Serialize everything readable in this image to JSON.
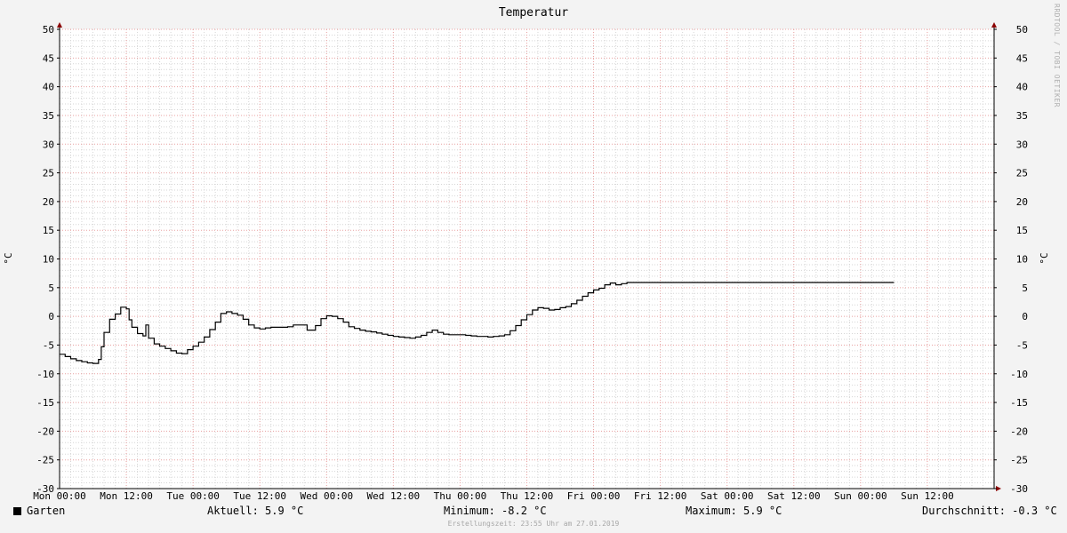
{
  "chart_data": {
    "type": "line",
    "title": "Temperatur",
    "ylabel": "°C",
    "ylabel_right": "°C",
    "ylim": [
      -30,
      50
    ],
    "yticks": [
      50,
      45,
      40,
      35,
      30,
      25,
      20,
      15,
      10,
      5,
      0,
      -5,
      -10,
      -15,
      -20,
      -25,
      -30
    ],
    "xlim_hours": [
      0,
      168
    ],
    "xticks": [
      {
        "label": "Mon 00:00",
        "h": 0
      },
      {
        "label": "Mon 12:00",
        "h": 12
      },
      {
        "label": "Tue 00:00",
        "h": 24
      },
      {
        "label": "Tue 12:00",
        "h": 36
      },
      {
        "label": "Wed 00:00",
        "h": 48
      },
      {
        "label": "Wed 12:00",
        "h": 60
      },
      {
        "label": "Thu 00:00",
        "h": 72
      },
      {
        "label": "Thu 12:00",
        "h": 84
      },
      {
        "label": "Fri 00:00",
        "h": 96
      },
      {
        "label": "Fri 12:00",
        "h": 108
      },
      {
        "label": "Sat 00:00",
        "h": 120
      },
      {
        "label": "Sat 12:00",
        "h": 132
      },
      {
        "label": "Sun 00:00",
        "h": 144
      },
      {
        "label": "Sun 12:00",
        "h": 156
      }
    ],
    "grid": true,
    "series": [
      {
        "name": "Garten",
        "color": "#000000",
        "points": [
          [
            0,
            -6.6
          ],
          [
            1,
            -7.0
          ],
          [
            2,
            -7.4
          ],
          [
            3,
            -7.7
          ],
          [
            4,
            -7.9
          ],
          [
            5,
            -8.1
          ],
          [
            6,
            -8.2
          ],
          [
            7,
            -7.5
          ],
          [
            7.5,
            -5.3
          ],
          [
            8,
            -2.8
          ],
          [
            9,
            -0.5
          ],
          [
            10,
            0.4
          ],
          [
            11,
            1.6
          ],
          [
            12,
            1.3
          ],
          [
            12.5,
            -0.6
          ],
          [
            13,
            -1.9
          ],
          [
            14,
            -3.0
          ],
          [
            15,
            -3.4
          ],
          [
            15.5,
            -1.5
          ],
          [
            16,
            -3.8
          ],
          [
            17,
            -4.8
          ],
          [
            18,
            -5.2
          ],
          [
            19,
            -5.6
          ],
          [
            20,
            -6.0
          ],
          [
            21,
            -6.4
          ],
          [
            22,
            -6.5
          ],
          [
            23,
            -5.8
          ],
          [
            24,
            -5.2
          ],
          [
            25,
            -4.5
          ],
          [
            26,
            -3.6
          ],
          [
            27,
            -2.3
          ],
          [
            28,
            -1.0
          ],
          [
            29,
            0.5
          ],
          [
            30,
            0.8
          ],
          [
            31,
            0.5
          ],
          [
            32,
            0.2
          ],
          [
            33,
            -0.5
          ],
          [
            34,
            -1.5
          ],
          [
            35,
            -2.0
          ],
          [
            36,
            -2.2
          ],
          [
            37,
            -2.0
          ],
          [
            38,
            -1.9
          ],
          [
            39,
            -1.9
          ],
          [
            40,
            -1.9
          ],
          [
            41,
            -1.8
          ],
          [
            42,
            -1.5
          ],
          [
            43,
            -1.5
          ],
          [
            44,
            -1.5
          ],
          [
            44.5,
            -2.4
          ],
          [
            45,
            -2.4
          ],
          [
            46,
            -1.6
          ],
          [
            47,
            -0.4
          ],
          [
            48,
            0.1
          ],
          [
            49,
            0.0
          ],
          [
            50,
            -0.4
          ],
          [
            51,
            -1.0
          ],
          [
            52,
            -1.8
          ],
          [
            53,
            -2.1
          ],
          [
            54,
            -2.4
          ],
          [
            55,
            -2.6
          ],
          [
            56,
            -2.7
          ],
          [
            57,
            -2.9
          ],
          [
            58,
            -3.1
          ],
          [
            59,
            -3.3
          ],
          [
            60,
            -3.5
          ],
          [
            61,
            -3.6
          ],
          [
            62,
            -3.7
          ],
          [
            63,
            -3.8
          ],
          [
            64,
            -3.6
          ],
          [
            65,
            -3.3
          ],
          [
            66,
            -2.8
          ],
          [
            67,
            -2.4
          ],
          [
            68,
            -2.8
          ],
          [
            69,
            -3.1
          ],
          [
            70,
            -3.2
          ],
          [
            71,
            -3.2
          ],
          [
            72,
            -3.2
          ],
          [
            73,
            -3.3
          ],
          [
            74,
            -3.4
          ],
          [
            75,
            -3.5
          ],
          [
            76,
            -3.5
          ],
          [
            77,
            -3.6
          ],
          [
            78,
            -3.5
          ],
          [
            79,
            -3.4
          ],
          [
            80,
            -3.2
          ],
          [
            81,
            -2.5
          ],
          [
            82,
            -1.6
          ],
          [
            83,
            -0.6
          ],
          [
            84,
            0.3
          ],
          [
            85,
            1.1
          ],
          [
            86,
            1.5
          ],
          [
            87,
            1.4
          ],
          [
            88,
            1.1
          ],
          [
            89,
            1.2
          ],
          [
            90,
            1.5
          ],
          [
            91,
            1.7
          ],
          [
            92,
            2.2
          ],
          [
            93,
            2.8
          ],
          [
            94,
            3.5
          ],
          [
            95,
            4.1
          ],
          [
            96,
            4.6
          ],
          [
            97,
            4.9
          ],
          [
            98,
            5.5
          ],
          [
            99,
            5.8
          ],
          [
            100,
            5.5
          ],
          [
            101,
            5.7
          ],
          [
            102,
            5.9
          ],
          [
            150,
            5.9
          ]
        ]
      }
    ],
    "legend": {
      "series_label": "Garten",
      "aktuell": "Aktuell: 5.9 °C",
      "minimum": "Minimum: -8.2 °C",
      "maximum": "Maximum: 5.9 °C",
      "durchschnitt": "Durchschnitt: -0.3 °C"
    },
    "footer": "Erstellungszeit: 23:55 Uhr am 27.01.2019",
    "watermark": "RRDTOOL / TOBI OETIKER"
  }
}
